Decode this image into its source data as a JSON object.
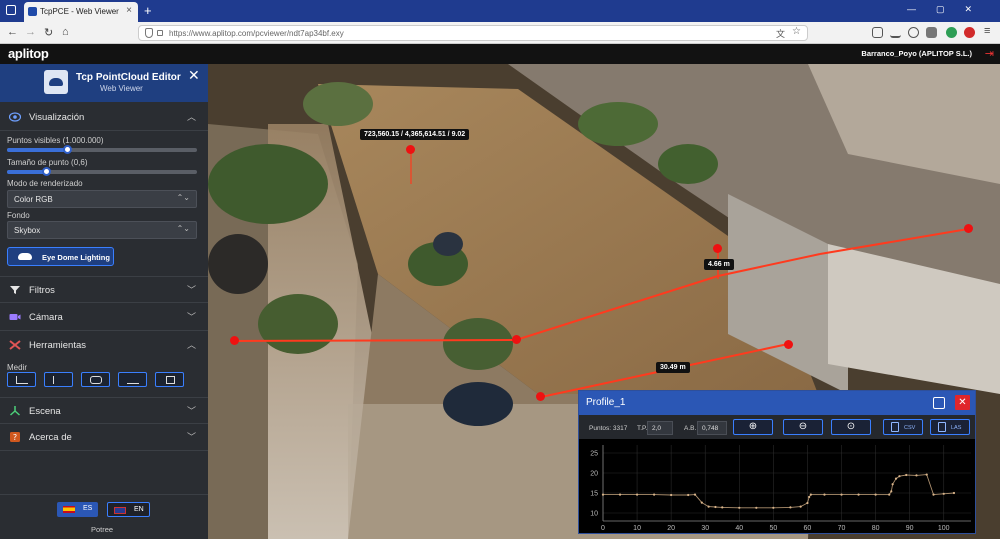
{
  "browser": {
    "tab_title": "TcpPCE - Web Viewer",
    "url": "https://www.aplitop.com/pcviewer/ndt7ap34bf.exy",
    "icons": [
      "tab-list-icon",
      "back-icon",
      "forward-icon",
      "reload-icon",
      "home-icon",
      "shield-icon",
      "lock-icon",
      "translate-icon",
      "star-icon",
      "pocket-icon",
      "downloads-icon",
      "account-icon",
      "extensions-icon",
      "menu-icon"
    ]
  },
  "app": {
    "logo": "aplitop",
    "account": "Barranco_Poyo (APLITOP S.L.)"
  },
  "sidebar": {
    "title": "Tcp PointCloud Editor",
    "subtitle": "Web Viewer",
    "visualization": {
      "label": "Visualización",
      "points_label": "Puntos visibles (1.000.000)",
      "points_fraction": 0.32,
      "size_label": "Tamaño de punto (0,6)",
      "size_fraction": 0.21,
      "render_mode_label": "Modo de renderizado",
      "render_mode_value": "Color RGB",
      "background_label": "Fondo",
      "background_value": "Skybox",
      "edl_button": "Eye Dome Lighting"
    },
    "sections": {
      "filters": "Filtros",
      "camera": "Cámara",
      "tools": "Herramientas",
      "measure_label": "Medir",
      "scene": "Escena",
      "about": "Acerca de"
    },
    "languages": {
      "es": "ES",
      "en": "EN"
    },
    "footer": "Potree"
  },
  "viewer": {
    "coordinate_label": "723,560.15 / 4,365,614.51 / 9.02",
    "height_label": "4.66 m",
    "distance_label": "30.49 m"
  },
  "profile": {
    "title": "Profile_1",
    "points_label": "Puntos: 3317",
    "tp_label": "T.P.",
    "tp_value": "2,0",
    "ab_label": "A.B.",
    "ab_value": "0,748",
    "csv_label": "CSV",
    "las_label": "LAS",
    "colors": {
      "accent": "#2b57b5",
      "close": "#e0262b",
      "points": "#d9b48a"
    }
  },
  "chart_data": {
    "type": "scatter",
    "x_ticks": [
      "0",
      "10",
      "20",
      "30",
      "40",
      "50",
      "60",
      "70",
      "80",
      "90",
      "100"
    ],
    "y_ticks": [
      "10",
      "15",
      "20",
      "25"
    ],
    "xlim": [
      0,
      108
    ],
    "ylim": [
      8,
      27
    ],
    "grid": true,
    "series": [
      {
        "x": [
          0,
          5,
          10,
          15,
          20,
          25,
          27,
          29,
          31,
          33,
          35,
          40,
          45,
          50,
          55,
          58,
          60,
          60.5,
          61,
          65,
          70,
          75,
          80,
          84,
          84.6,
          85,
          86,
          87,
          89,
          92,
          95,
          97,
          100,
          103
        ],
        "y": [
          14.6,
          14.6,
          14.6,
          14.6,
          14.5,
          14.5,
          14.6,
          12.6,
          11.6,
          11.5,
          11.4,
          11.3,
          11.3,
          11.3,
          11.4,
          11.6,
          12.5,
          14.0,
          14.6,
          14.6,
          14.6,
          14.6,
          14.6,
          14.6,
          15.4,
          17.2,
          18.6,
          19.2,
          19.5,
          19.4,
          19.6,
          14.6,
          14.8,
          15.0
        ]
      }
    ]
  }
}
